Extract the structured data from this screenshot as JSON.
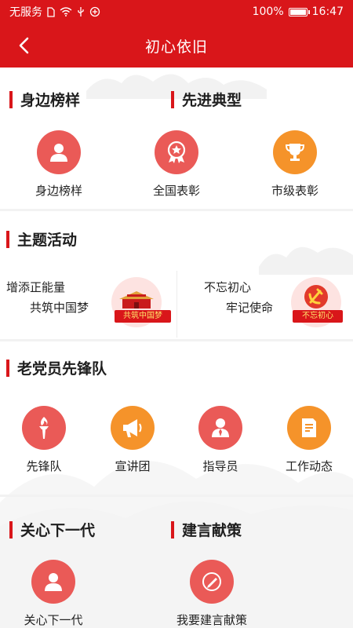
{
  "status_bar": {
    "carrier": "无服务",
    "battery_pct": "100%",
    "time": "16:47"
  },
  "nav": {
    "title": "初心依旧"
  },
  "section_role_models": {
    "left_title": "身边榜样",
    "right_title": "先进典型"
  },
  "role_models": [
    {
      "label": "身边榜样",
      "icon": "person-icon",
      "color": "#ea5a57"
    },
    {
      "label": "全国表彰",
      "icon": "star-medal-icon",
      "color": "#ea5a57"
    },
    {
      "label": "市级表彰",
      "icon": "trophy-icon",
      "color": "#f5932a"
    }
  ],
  "section_theme": {
    "title": "主题活动"
  },
  "activities": [
    {
      "line1": "增添正能量",
      "line2": "共筑中国梦",
      "ribbon": "共筑中国梦"
    },
    {
      "line1": "不忘初心",
      "line2": "牢记使命",
      "ribbon": "不忘初心"
    }
  ],
  "section_vanguard": {
    "title": "老党员先锋队"
  },
  "vanguard": [
    {
      "label": "先锋队",
      "icon": "torch-icon",
      "color": "#ea5a57"
    },
    {
      "label": "宣讲团",
      "icon": "megaphone-icon",
      "color": "#f5932a"
    },
    {
      "label": "指导员",
      "icon": "instructor-icon",
      "color": "#ea5a57"
    },
    {
      "label": "工作动态",
      "icon": "document-icon",
      "color": "#f5932a"
    }
  ],
  "section_bottom": {
    "left_title": "关心下一代",
    "right_title": "建言献策"
  },
  "bottom_items": [
    {
      "label": "关心下一代",
      "icon": "person-icon",
      "color": "#ea5a57"
    },
    {
      "label": "我要建言献策",
      "icon": "pen-icon",
      "color": "#ea5a57"
    }
  ],
  "colors": {
    "brand_red": "#d9161a",
    "coral": "#ea5a57",
    "orange": "#f5932a"
  }
}
